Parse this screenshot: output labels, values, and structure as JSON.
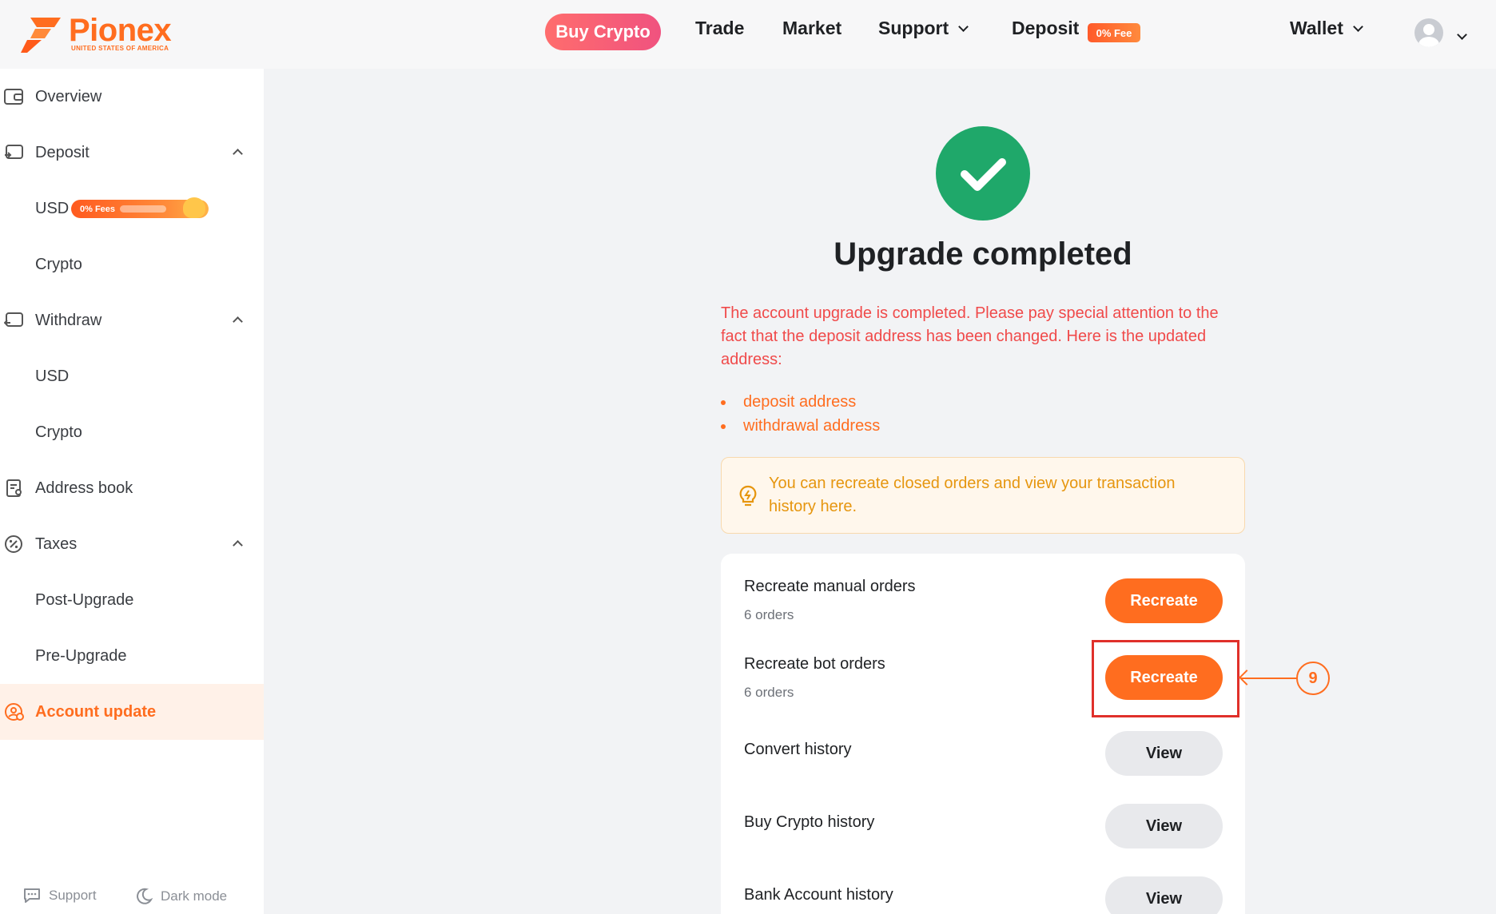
{
  "brand": {
    "name": "Pionex",
    "subtitle": "UNITED STATES OF AMERICA",
    "accent": "#ff6d1f"
  },
  "nav": {
    "buy_crypto": "Buy Crypto",
    "trade": "Trade",
    "market": "Market",
    "support": "Support",
    "deposit": "Deposit",
    "deposit_badge": "0% Fee",
    "wallet": "Wallet"
  },
  "sidebar": {
    "overview": "Overview",
    "deposit": "Deposit",
    "deposit_usd": "USD",
    "deposit_usd_badge": "0% Fees",
    "deposit_crypto": "Crypto",
    "withdraw": "Withdraw",
    "withdraw_usd": "USD",
    "withdraw_crypto": "Crypto",
    "address_book": "Address book",
    "taxes": "Taxes",
    "post_upgrade": "Post-Upgrade",
    "pre_upgrade": "Pre-Upgrade",
    "account_update": "Account update",
    "footer_support": "Support",
    "footer_dark_mode": "Dark mode"
  },
  "main": {
    "title": "Upgrade completed",
    "notice": "The account upgrade is completed. Please pay special attention to the fact that the deposit address has been changed. Here is the updated address:",
    "bullets": [
      "deposit address",
      "withdrawal address"
    ],
    "tip": "You can recreate closed orders and view your transaction history here.",
    "rows": [
      {
        "label": "Recreate manual orders",
        "sub": "6 orders",
        "button": "Recreate"
      },
      {
        "label": "Recreate bot orders",
        "sub": "6 orders",
        "button": "Recreate"
      },
      {
        "label": "Convert history",
        "button": "View"
      },
      {
        "label": "Buy Crypto history",
        "button": "View"
      },
      {
        "label": "Bank Account history",
        "button": "View"
      }
    ],
    "step_marker": "9"
  },
  "colors": {
    "success": "#1fa86a",
    "warning_text": "#f04a4a",
    "tip_text": "#e6960f",
    "highlight_box": "#e0302a"
  }
}
